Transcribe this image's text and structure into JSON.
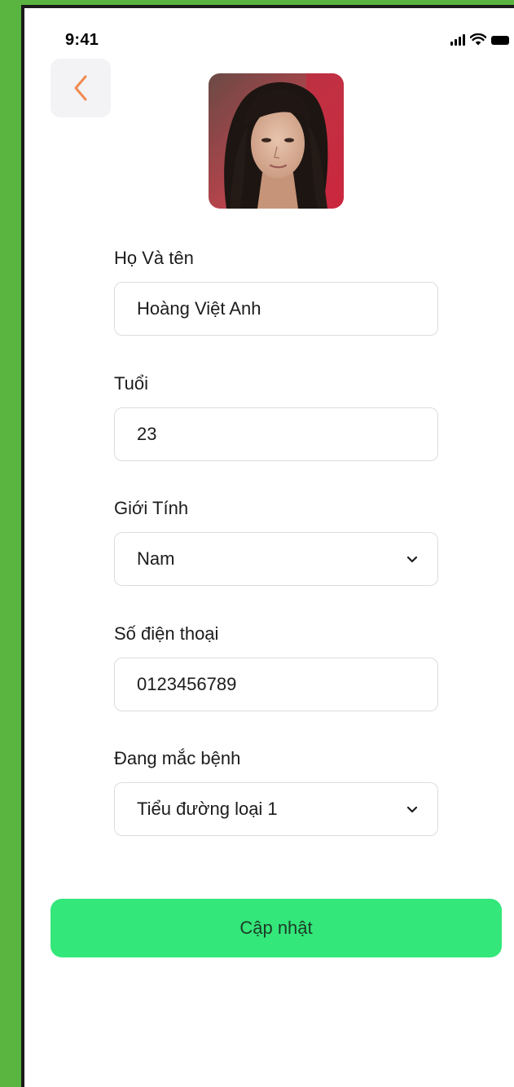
{
  "status_bar": {
    "time": "9:41"
  },
  "header": {
    "back_icon": "chevron-left-icon",
    "back_color": "#f08a4f"
  },
  "form": {
    "name": {
      "label": "Họ Và tên",
      "value": "Hoàng Việt Anh"
    },
    "age": {
      "label": "Tuổi",
      "value": "23"
    },
    "gender": {
      "label": "Giới Tính",
      "value": "Nam",
      "icon": "chevron-down-icon"
    },
    "phone": {
      "label": "Số điện thoại",
      "value": "0123456789"
    },
    "disease": {
      "label": "Đang mắc bệnh",
      "value": "Tiểu đường loại 1",
      "icon": "chevron-down-icon"
    }
  },
  "actions": {
    "submit_label": "Cập nhật",
    "submit_color": "#33e77a"
  },
  "colors": {
    "page_background": "#5ab540",
    "screen_background": "#ffffff"
  }
}
